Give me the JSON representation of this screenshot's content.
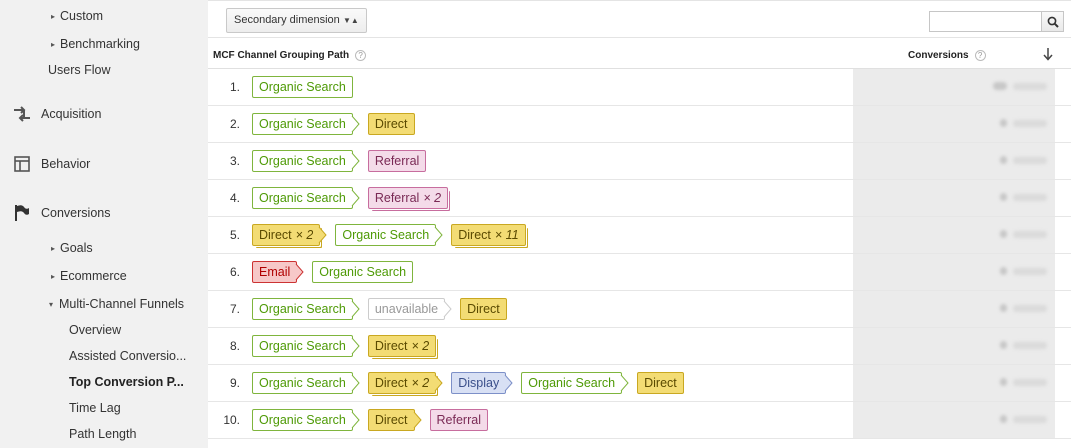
{
  "sidebar": {
    "custom": "Custom",
    "benchmarking": "Benchmarking",
    "users_flow": "Users Flow",
    "acquisition": "Acquisition",
    "behavior": "Behavior",
    "conversions": "Conversions",
    "goals": "Goals",
    "ecommerce": "Ecommerce",
    "multi_channel_funnels": "Multi-Channel Funnels",
    "overview": "Overview",
    "assisted_conversions": "Assisted Conversio...",
    "top_conversion_paths": "Top Conversion P...",
    "time_lag": "Time Lag",
    "path_length": "Path Length"
  },
  "toolbar": {
    "secondary_dimension": "Secondary dimension",
    "search_value": ""
  },
  "table": {
    "col_path": "MCF Channel Grouping Path",
    "col_conversions": "Conversions",
    "rows": [
      {
        "num": "1.",
        "steps": [
          {
            "type": "organic",
            "label": "Organic Search",
            "times": ""
          }
        ]
      },
      {
        "num": "2.",
        "steps": [
          {
            "type": "organic",
            "label": "Organic Search",
            "times": ""
          },
          {
            "type": "direct",
            "label": "Direct",
            "times": ""
          }
        ]
      },
      {
        "num": "3.",
        "steps": [
          {
            "type": "organic",
            "label": "Organic Search",
            "times": ""
          },
          {
            "type": "referral",
            "label": "Referral",
            "times": ""
          }
        ]
      },
      {
        "num": "4.",
        "steps": [
          {
            "type": "organic",
            "label": "Organic Search",
            "times": ""
          },
          {
            "type": "referral",
            "label": "Referral",
            "times": "× 2"
          }
        ]
      },
      {
        "num": "5.",
        "steps": [
          {
            "type": "direct",
            "label": "Direct",
            "times": "× 2"
          },
          {
            "type": "organic",
            "label": "Organic Search",
            "times": ""
          },
          {
            "type": "direct",
            "label": "Direct",
            "times": "× 11"
          }
        ]
      },
      {
        "num": "6.",
        "steps": [
          {
            "type": "email",
            "label": "Email",
            "times": ""
          },
          {
            "type": "organic",
            "label": "Organic Search",
            "times": ""
          }
        ]
      },
      {
        "num": "7.",
        "steps": [
          {
            "type": "organic",
            "label": "Organic Search",
            "times": ""
          },
          {
            "type": "unavailable",
            "label": "unavailable",
            "times": ""
          },
          {
            "type": "direct",
            "label": "Direct",
            "times": ""
          }
        ]
      },
      {
        "num": "8.",
        "steps": [
          {
            "type": "organic",
            "label": "Organic Search",
            "times": ""
          },
          {
            "type": "direct",
            "label": "Direct",
            "times": "× 2"
          }
        ]
      },
      {
        "num": "9.",
        "steps": [
          {
            "type": "organic",
            "label": "Organic Search",
            "times": ""
          },
          {
            "type": "direct",
            "label": "Direct",
            "times": "× 2"
          },
          {
            "type": "display",
            "label": "Display",
            "times": ""
          },
          {
            "type": "organic",
            "label": "Organic Search",
            "times": ""
          },
          {
            "type": "direct",
            "label": "Direct",
            "times": ""
          }
        ]
      },
      {
        "num": "10.",
        "steps": [
          {
            "type": "organic",
            "label": "Organic Search",
            "times": ""
          },
          {
            "type": "direct",
            "label": "Direct",
            "times": ""
          },
          {
            "type": "referral",
            "label": "Referral",
            "times": ""
          }
        ]
      }
    ]
  },
  "colors": {
    "organic": "#4e9a06",
    "direct_bg": "#f3dc74",
    "referral_bg": "#f4dbe9",
    "email_bg": "#f7c8c8",
    "display_bg": "#d8e0f4",
    "sidebar_bg": "#f1f1f1"
  },
  "icons": {
    "acquisition": "arrows-icon",
    "behavior": "layout-icon",
    "conversions": "flag-icon",
    "search": "search-icon",
    "sort": "arrow-down-icon"
  }
}
